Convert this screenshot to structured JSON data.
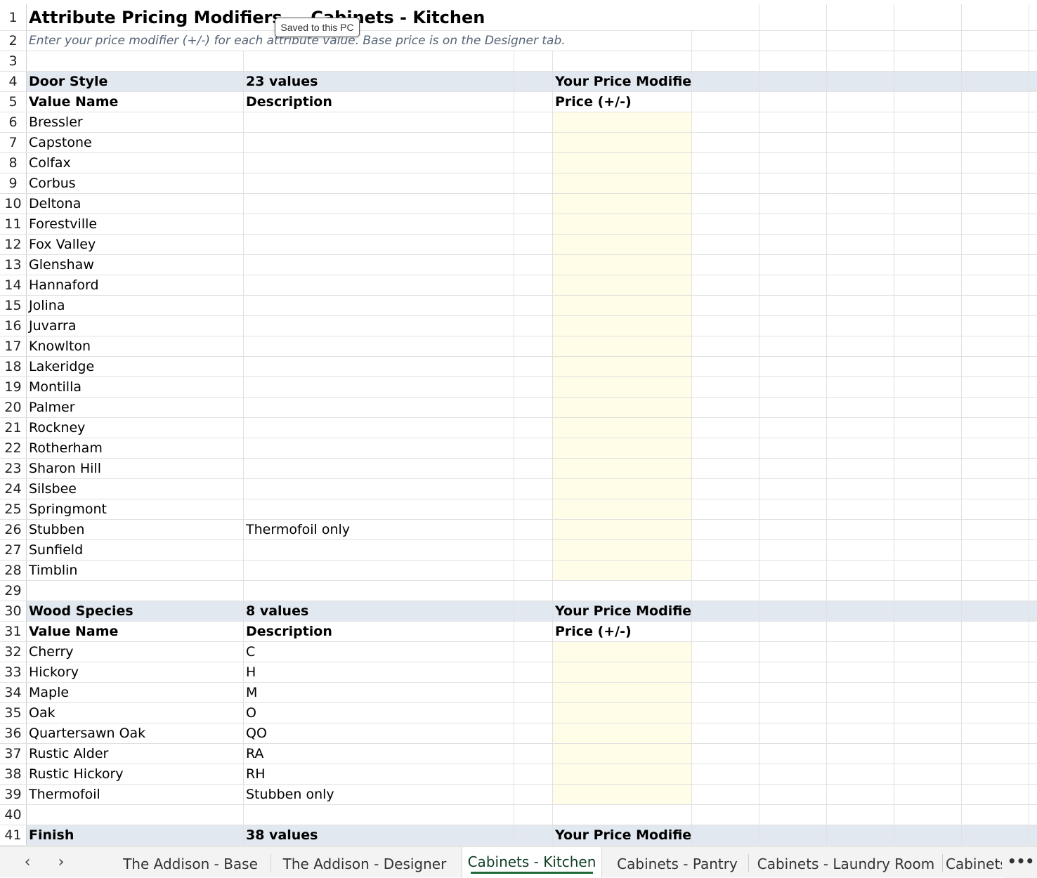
{
  "sheet": {
    "title": "Attribute Pricing Modifiers — Cabinets - Kitchen",
    "subtitle": "Enter your price modifier (+/-) for each attribute value. Base price is on the Designer tab.",
    "tooltip": "Saved to this PC"
  },
  "rows": [
    {
      "n": "1",
      "type": "title"
    },
    {
      "n": "2",
      "type": "subtitle"
    },
    {
      "n": "3",
      "type": "empty"
    },
    {
      "n": "4",
      "type": "section",
      "a": "Door Style",
      "b": "23 values",
      "d": "Your Price Modifier"
    },
    {
      "n": "5",
      "type": "header",
      "a": "Value Name",
      "b": "Description",
      "d": "Price (+/-)"
    },
    {
      "n": "6",
      "type": "value",
      "a": "Bressler",
      "b": ""
    },
    {
      "n": "7",
      "type": "value",
      "a": "Capstone",
      "b": ""
    },
    {
      "n": "8",
      "type": "value",
      "a": "Colfax",
      "b": ""
    },
    {
      "n": "9",
      "type": "value",
      "a": "Corbus",
      "b": ""
    },
    {
      "n": "10",
      "type": "value",
      "a": "Deltona",
      "b": ""
    },
    {
      "n": "11",
      "type": "value",
      "a": "Forestville",
      "b": ""
    },
    {
      "n": "12",
      "type": "value",
      "a": "Fox Valley",
      "b": ""
    },
    {
      "n": "13",
      "type": "value",
      "a": "Glenshaw",
      "b": ""
    },
    {
      "n": "14",
      "type": "value",
      "a": "Hannaford",
      "b": ""
    },
    {
      "n": "15",
      "type": "value",
      "a": "Jolina",
      "b": ""
    },
    {
      "n": "16",
      "type": "value",
      "a": "Juvarra",
      "b": ""
    },
    {
      "n": "17",
      "type": "value",
      "a": "Knowlton",
      "b": ""
    },
    {
      "n": "18",
      "type": "value",
      "a": "Lakeridge",
      "b": ""
    },
    {
      "n": "19",
      "type": "value",
      "a": "Montilla",
      "b": ""
    },
    {
      "n": "20",
      "type": "value",
      "a": "Palmer",
      "b": ""
    },
    {
      "n": "21",
      "type": "value",
      "a": "Rockney",
      "b": ""
    },
    {
      "n": "22",
      "type": "value",
      "a": "Rotherham",
      "b": ""
    },
    {
      "n": "23",
      "type": "value",
      "a": "Sharon Hill",
      "b": ""
    },
    {
      "n": "24",
      "type": "value",
      "a": "Silsbee",
      "b": ""
    },
    {
      "n": "25",
      "type": "value",
      "a": "Springmont",
      "b": ""
    },
    {
      "n": "26",
      "type": "value",
      "a": "Stubben",
      "b": "Thermofoil only"
    },
    {
      "n": "27",
      "type": "value",
      "a": "Sunfield",
      "b": ""
    },
    {
      "n": "28",
      "type": "value",
      "a": "Timblin",
      "b": ""
    },
    {
      "n": "29",
      "type": "empty"
    },
    {
      "n": "30",
      "type": "section",
      "a": "Wood Species",
      "b": "8 values",
      "d": "Your Price Modifier"
    },
    {
      "n": "31",
      "type": "header",
      "a": "Value Name",
      "b": "Description",
      "d": "Price (+/-)"
    },
    {
      "n": "32",
      "type": "value",
      "a": "Cherry",
      "b": "C"
    },
    {
      "n": "33",
      "type": "value",
      "a": "Hickory",
      "b": "H"
    },
    {
      "n": "34",
      "type": "value",
      "a": "Maple",
      "b": "M"
    },
    {
      "n": "35",
      "type": "value",
      "a": "Oak",
      "b": "O"
    },
    {
      "n": "36",
      "type": "value",
      "a": "Quartersawn Oak",
      "b": "QO"
    },
    {
      "n": "37",
      "type": "value",
      "a": "Rustic Alder",
      "b": "RA"
    },
    {
      "n": "38",
      "type": "value",
      "a": "Rustic Hickory",
      "b": "RH"
    },
    {
      "n": "39",
      "type": "value",
      "a": "Thermofoil",
      "b": "Stubben only"
    },
    {
      "n": "40",
      "type": "empty"
    },
    {
      "n": "41",
      "type": "section",
      "a": "Finish",
      "b": "38 values",
      "d": "Your Price Modifier"
    }
  ],
  "tabbar": {
    "prev_icon": "chevron-left-icon",
    "next_icon": "chevron-right-icon",
    "more_icon": "more-icon",
    "tabs": [
      {
        "label": "The Addison  - Base",
        "active": false
      },
      {
        "label": "The Addison  - Designer",
        "active": false
      },
      {
        "label": "Cabinets - Kitchen",
        "active": true
      },
      {
        "label": "Cabinets - Pantry",
        "active": false
      },
      {
        "label": "Cabinets - Laundry Room",
        "active": false
      },
      {
        "label": "Cabinets",
        "active": false
      }
    ]
  },
  "colors": {
    "section_bg": "#e2e8f0",
    "input_bg": "#fffde7",
    "active_tab_underline": "#1f6b3a"
  }
}
